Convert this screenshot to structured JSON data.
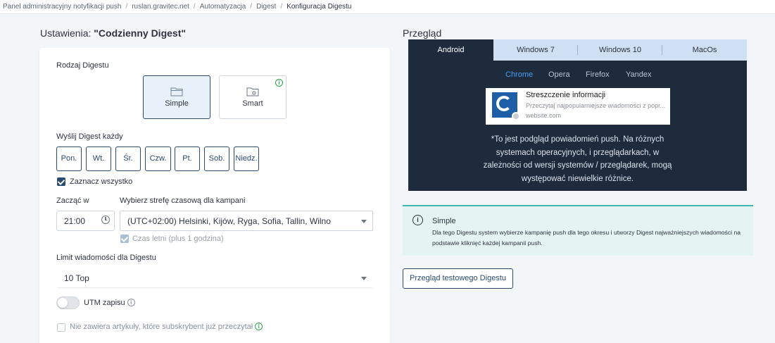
{
  "breadcrumb": [
    "Panel administracyjny notyfikacji push",
    "ruslan.gravitec.net",
    "Automatyzacja",
    "Digest",
    "Konfiguracja Digestu"
  ],
  "settings": {
    "title_prefix": "Ustawienia:",
    "title_name": "\"Codzienny Digest\"",
    "digest_type_label": "Rodzaj Digestu",
    "types": [
      {
        "label": "Simple",
        "icon": "folder-icon",
        "selected": true
      },
      {
        "label": "Smart",
        "icon": "folder-gear-icon",
        "selected": false,
        "info": "i"
      }
    ],
    "send_every_label": "Wyślij Digest każdy",
    "days": [
      "Pon.",
      "Wt.",
      "Śr.",
      "Czw.",
      "Pt.",
      "Sob.",
      "Niedz."
    ],
    "select_all_label": "Zaznacz wszystko",
    "select_all_checked": true,
    "start_label": "Zacząć w",
    "start_time": "21:00",
    "timezone_label": "Wybierz strefę czasową dla kampani",
    "timezone_value": "(UTC+02:00) Helsinki, Kijów, Ryga, Sofia, Tallin, Wilno",
    "dst_label": "Czas letni (plus 1 godzina)",
    "limit_label": "Limit wiadomości dla Digestu",
    "limit_value": "10 Top",
    "utm_label": "UTM zapisu",
    "utm_enabled": false,
    "exclude_read_label": "Nie zawiera artykuły, które subskrybent już przeczytał",
    "exclude_read_checked": false
  },
  "preview": {
    "title": "Przegląd",
    "os_tabs": [
      "Android",
      "Windows 7",
      "Windows 10",
      "MacOs"
    ],
    "active_os": "Android",
    "browsers": [
      "Chrome",
      "Opera",
      "Firefox",
      "Yandex"
    ],
    "active_browser": "Chrome",
    "notification": {
      "title": "Streszczenie informacji",
      "body": "Przeczytaj najpopularniejsze wiadomości z popr...",
      "site": "website.com"
    },
    "disclaimer": "*To jest podgląd powiadomień push. Na różnych systemach operacyjnych, i przeglądarkach, w zależności od wersji systemów / przeglądarek, mogą występować niewielkie różnice."
  },
  "info": {
    "title": "Simple",
    "text": "Dla tego Digestu system wybierze kampanię push dla tego okresu i utworzy Digest najważniejszych wiadomości na podstawie kliknięć każdej kampanii push."
  },
  "test_button_label": "Przegląd testowego Digestu",
  "colors": {
    "accent": "#2b4a6f",
    "preview_bg": "#1e2b3d",
    "tab_bg": "#cfe0f5",
    "info_bg": "#e4f4f2",
    "info_border": "#3fb6b1",
    "link": "#4a9ff5"
  }
}
